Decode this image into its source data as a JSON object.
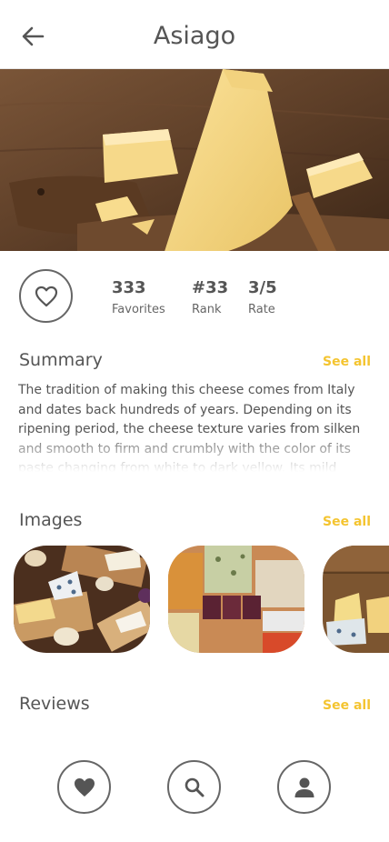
{
  "header": {
    "title": "Asiago",
    "back_icon": "arrow-left-icon"
  },
  "stats": {
    "favorites_value": "333",
    "favorites_label": "Favorites",
    "rank_value": "#33",
    "rank_label": "Rank",
    "rate_value": "3/5",
    "rate_label": "Rate"
  },
  "summary": {
    "title": "Summary",
    "see_all": "See all",
    "text": "The tradition of making this cheese comes from Italy and dates back hundreds of years. Depending on its ripening period, the cheese texture varies from silken and smooth to firm and crumbly with the color of its paste changing from white to dark yellow. Its mild smell and piquant"
  },
  "images": {
    "title": "Images",
    "see_all": "See all"
  },
  "reviews": {
    "title": "Reviews",
    "see_all": "See all"
  },
  "bottom_nav": [
    "heart-icon",
    "search-icon",
    "user-icon"
  ],
  "colors": {
    "accent": "#f4c430",
    "text": "#555555",
    "outline": "#666666"
  }
}
